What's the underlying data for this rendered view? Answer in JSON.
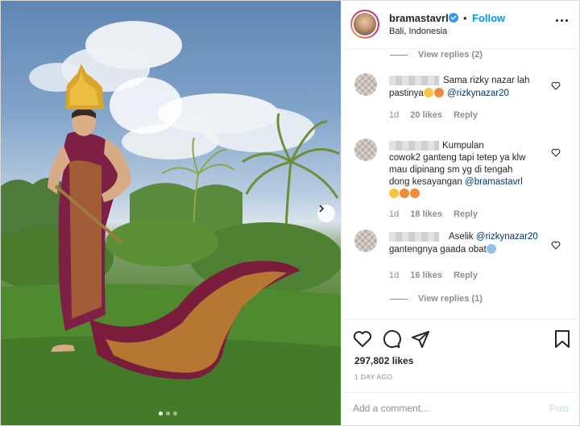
{
  "header": {
    "username": "bramastavrl",
    "follow_separator": "•",
    "follow_label": "Follow",
    "location": "Bali, Indonesia"
  },
  "comments": {
    "view_replies_top": "View replies (2)",
    "items": [
      {
        "text_line1": "Sama rizky nazar lah",
        "text_line2_prefix": "pastinya",
        "mention": "@rizkynazar20",
        "time": "1d",
        "likes": "20 likes",
        "reply": "Reply"
      },
      {
        "text_line1": "Kumpulan",
        "text_line2": "cowok2 ganteng tapi tetep ya klw",
        "text_line3": "mau dipinang sm yg di tengah",
        "text_line4_prefix": "dong kesayangan",
        "mention": "@bramastavrl",
        "time": "1d",
        "likes": "18 likes",
        "reply": "Reply"
      },
      {
        "text_line1": "Aselik",
        "mention": "@rizkynazar20",
        "text_line2": "gantengnya gaada obat",
        "time": "1d",
        "likes": "16 likes",
        "reply": "Reply"
      }
    ],
    "view_replies_bottom": "View replies (1)"
  },
  "actions": {
    "likes": "297,802 likes",
    "time": "1 DAY AGO",
    "add_comment_placeholder": "Add a comment…",
    "post_label": "Post"
  },
  "icons": [
    "verified-badge-icon",
    "more-options-icon",
    "heart-icon",
    "comment-icon",
    "share-icon",
    "bookmark-icon",
    "next-arrow-icon"
  ],
  "colors": {
    "link_blue": "#0095f6",
    "mention_blue": "#00376b",
    "muted": "#8e8e8e"
  }
}
